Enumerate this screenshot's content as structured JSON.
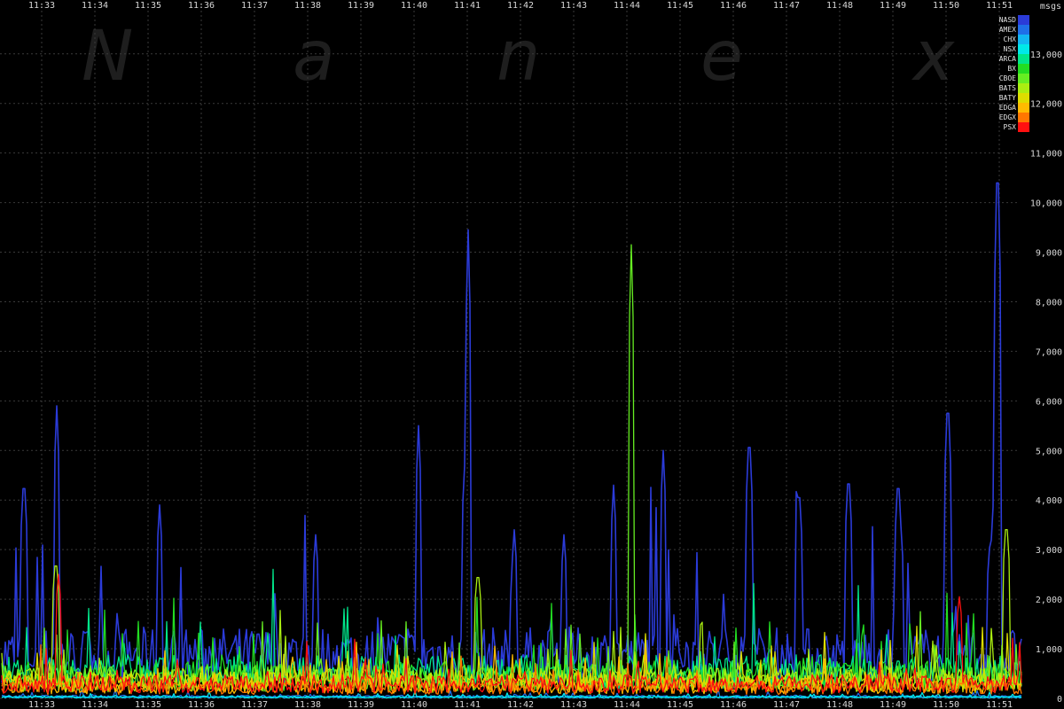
{
  "watermark": [
    "N",
    "a",
    "n",
    "e",
    "x"
  ],
  "chart_data": {
    "type": "line",
    "title": "",
    "xlabel": "",
    "ylabel": "msgs",
    "x_ticks": [
      "11:33",
      "11:34",
      "11:35",
      "11:36",
      "11:37",
      "11:38",
      "11:39",
      "11:40",
      "11:41",
      "11:42",
      "11:43",
      "11:44",
      "11:45",
      "11:46",
      "11:47",
      "11:48",
      "11:49",
      "11:50",
      "11:51"
    ],
    "x_range": [
      "11:33",
      "11:51"
    ],
    "y_ticks": [
      0,
      1000,
      2000,
      3000,
      4000,
      5000,
      6000,
      7000,
      8000,
      9000,
      10000,
      11000,
      12000,
      13000
    ],
    "y_tick_labels": [
      "0",
      "1,000",
      "2,000",
      "3,000",
      "4,000",
      "5,000",
      "6,000",
      "7,000",
      "8,000",
      "9,000",
      "10,000",
      "11,000",
      "12,000",
      "13,000"
    ],
    "ylim": [
      0,
      13800
    ],
    "grid": true,
    "legend": "top-right",
    "series": [
      {
        "name": "NASD",
        "color": "#2b3bd8",
        "baseline": 900,
        "spikes": [
          [
            "11:33",
            4600
          ],
          [
            "11:33",
            5900
          ],
          [
            "11:35",
            3900
          ],
          [
            "11:38",
            3300
          ],
          [
            "11:40",
            5500
          ],
          [
            "11:41",
            9450
          ],
          [
            "11:41",
            4700
          ],
          [
            "11:42",
            3400
          ],
          [
            "11:43",
            3300
          ],
          [
            "11:44",
            4300
          ],
          [
            "11:45",
            5000
          ],
          [
            "11:46",
            5500
          ],
          [
            "11:47",
            4400
          ],
          [
            "11:48",
            4700
          ],
          [
            "11:49",
            4600
          ],
          [
            "11:50",
            6250
          ],
          [
            "11:51",
            11300
          ],
          [
            "11:51",
            4200
          ],
          [
            "11:51",
            3300
          ]
        ]
      },
      {
        "name": "AMEX",
        "color": "#1f6fe8",
        "baseline": 40,
        "spikes": []
      },
      {
        "name": "CHX",
        "color": "#12b6f2",
        "baseline": 20,
        "spikes": []
      },
      {
        "name": "NSX",
        "color": "#00e8e8",
        "baseline": 30,
        "spikes": []
      },
      {
        "name": "ARCA",
        "color": "#00e68a",
        "baseline": 550,
        "spikes": []
      },
      {
        "name": "BX",
        "color": "#22dd22",
        "baseline": 480,
        "spikes": []
      },
      {
        "name": "CBOE",
        "color": "#66ee22",
        "baseline": 420,
        "spikes": [
          [
            "11:44",
            9150
          ]
        ]
      },
      {
        "name": "BATS",
        "color": "#aaee11",
        "baseline": 380,
        "spikes": [
          [
            "11:33",
            2900
          ],
          [
            "11:41",
            2650
          ],
          [
            "11:51",
            3700
          ]
        ]
      },
      {
        "name": "BATY",
        "color": "#dddd00",
        "baseline": 340,
        "spikes": []
      },
      {
        "name": "EDGA",
        "color": "#ffbb00",
        "baseline": 260,
        "spikes": []
      },
      {
        "name": "EDGX",
        "color": "#ff7700",
        "baseline": 220,
        "spikes": []
      },
      {
        "name": "PSX",
        "color": "#ff1010",
        "baseline": 300,
        "spikes": [
          [
            "11:33",
            2500
          ],
          [
            "11:50",
            2050
          ]
        ]
      }
    ]
  }
}
